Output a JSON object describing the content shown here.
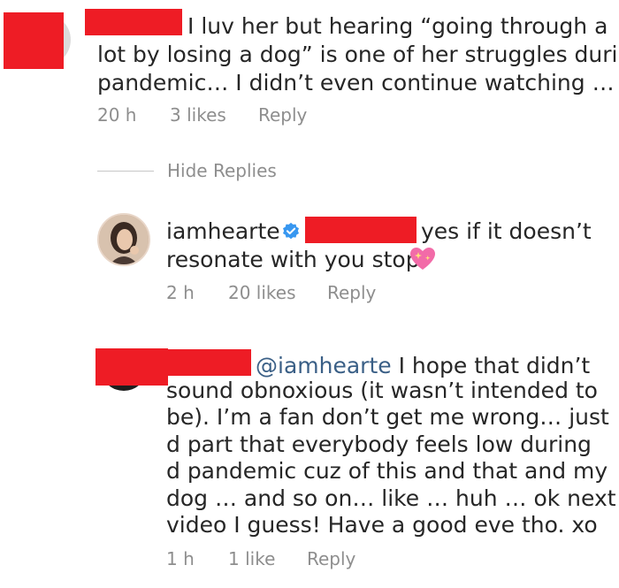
{
  "comments": [
    {
      "text_lines": [
        "I luv her but hearing “going through a",
        "lot by losing a dog” is one of her struggles during",
        "pandemic… I didn’t even continue watching …"
      ],
      "time": "20 h",
      "likes": "3 likes",
      "reply": "Reply"
    }
  ],
  "hide_replies": "Hide Replies",
  "reply_main": {
    "username": "iamhearte",
    "line1": "yes if it doesn’t",
    "line2": "resonate with you stop",
    "emoji": "💖",
    "time": "2 h",
    "likes": "20 likes",
    "reply": "Reply"
  },
  "reply_second": {
    "mention": "@iamhearte",
    "line1_rest": " I hope that didn’t",
    "lines": [
      "sound obnoxious (it wasn’t intended to",
      "be). I’m a fan don’t get me wrong… just",
      "d part that everybody feels low during",
      "d pandemic cuz of this and that and my",
      "dog … and so on… like … huh … ok next",
      "video I guess! Have a good eve tho. xo"
    ],
    "time": "1 h",
    "likes": "1 like",
    "reply": "Reply"
  },
  "colors": {
    "redaction": "#ee1c25",
    "verified": "#3897f0",
    "mention": "#3a5f86",
    "meta": "#8e8e8e"
  }
}
